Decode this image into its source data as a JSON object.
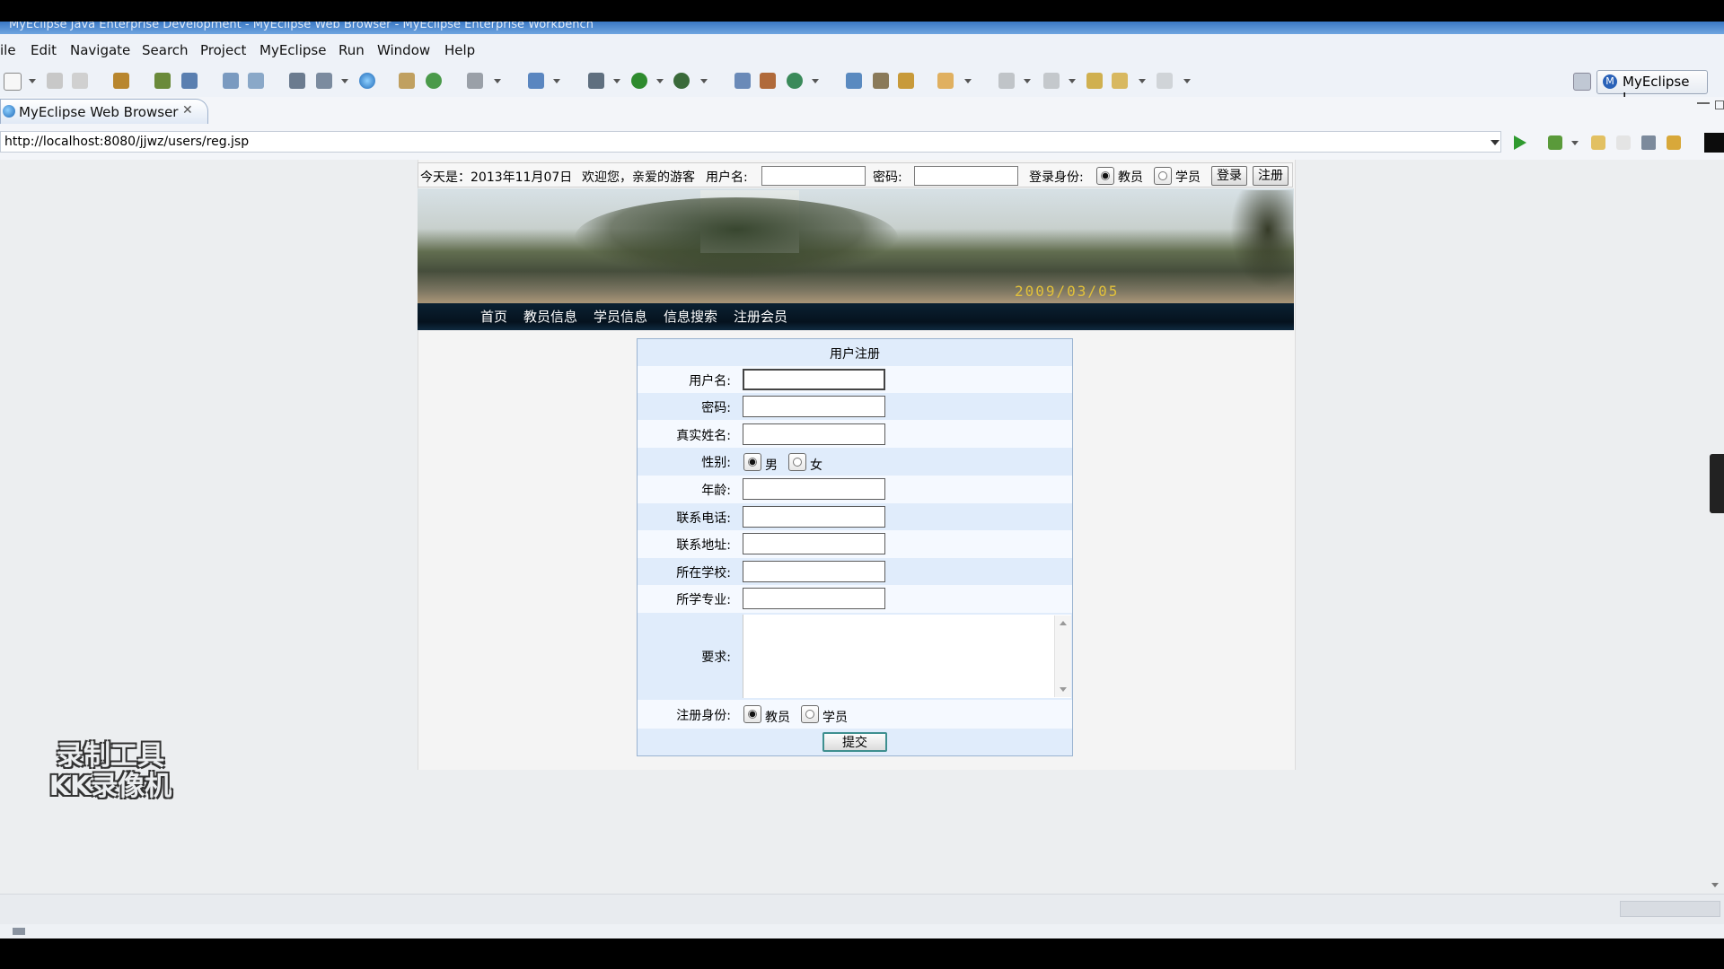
{
  "window": {
    "title": "MyEclipse Java Enterprise Development - MyEclipse Web Browser - MyEclipse Enterprise Workbench"
  },
  "menu": [
    "ile",
    "Edit",
    "Navigate",
    "Search",
    "Project",
    "MyEclipse",
    "Run",
    "Window",
    "Help"
  ],
  "toolbar": {
    "perspective_label": "MyEclipse J...",
    "perspective_icon": "M"
  },
  "editor_tab": {
    "label": "MyEclipse Web Browser",
    "close": "✕"
  },
  "browser": {
    "url": "http://localhost:8080/jjwz/users/reg.jsp"
  },
  "page": {
    "topbar": {
      "date_text": "今天是：2013年11月07日",
      "welcome_text": "欢迎您，亲爱的游客",
      "username_label": "用户名:",
      "password_label": "密码:",
      "role_label": "登录身份:",
      "role_teacher": "教员",
      "role_student": "学员",
      "login_button": "登录",
      "register_button": "注册",
      "selected_role": "教员"
    },
    "banner": {
      "date_stamp": "2009/03/05"
    },
    "nav": [
      "首页",
      "教员信息",
      "学员信息",
      "信息搜索",
      "注册会员"
    ],
    "form": {
      "title": "用户注册",
      "fields": [
        {
          "label": "用户名:",
          "value": ""
        },
        {
          "label": "密码:",
          "value": ""
        },
        {
          "label": "真实姓名:",
          "value": ""
        },
        {
          "label": "性别:",
          "options": [
            "男",
            "女"
          ],
          "selected": "男"
        },
        {
          "label": "年龄:",
          "value": ""
        },
        {
          "label": "联系电话:",
          "value": ""
        },
        {
          "label": "联系地址:",
          "value": ""
        },
        {
          "label": "所在学校:",
          "value": ""
        },
        {
          "label": "所学专业:",
          "value": ""
        },
        {
          "label": "要求:",
          "value": ""
        },
        {
          "label": "注册身份:",
          "options": [
            "教员",
            "学员"
          ],
          "selected": "教员"
        }
      ],
      "submit_label": "提交"
    }
  },
  "watermark": {
    "line1": "录制工具",
    "line2": "KK录像机"
  }
}
